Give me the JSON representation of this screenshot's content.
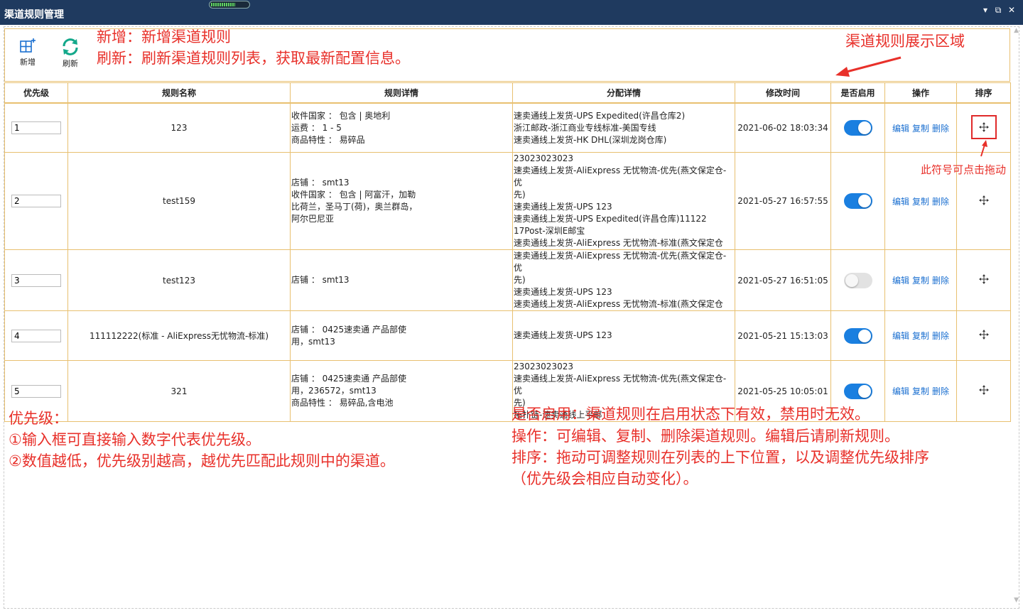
{
  "window": {
    "title": "渠道规则管理",
    "progress_fraction": 0.65,
    "controls": [
      "▾",
      "⧉",
      "✕"
    ]
  },
  "toolbar": {
    "add_label": "新增",
    "refresh_label": "刷新"
  },
  "annotations": {
    "toolbar_line1": "新增：新增渠道规则",
    "toolbar_line2": "刷新：刷新渠道规则列表，获取最新配置信息。",
    "display_area": "渠道规则展示区域",
    "drag_hint": "此符号可点击拖动",
    "priority_title": "优先级：",
    "priority_line1": "①输入框可直接输入数字代表优先级。",
    "priority_line2": "②数值越低，优先级别越高，越优先匹配此规则中的渠道。",
    "enable_line": "是否启用：渠道规则在启用状态下有效，禁用时无效。",
    "operation_line": "操作：可编辑、复制、删除渠道规则。编辑后请刷新规则。",
    "sort_line1": "排序：拖动可调整规则在列表的上下位置，以及调整优先级排序",
    "sort_line2": "（优先级会相应自动变化）。",
    "arrow_color": "#e8302a"
  },
  "table": {
    "headers": {
      "priority": "优先级",
      "name": "规则名称",
      "detail": "规则详情",
      "allocation": "分配详情",
      "modified": "修改时间",
      "enabled": "是否启用",
      "operation": "操作",
      "sort": "排序"
    },
    "op_labels": {
      "edit": "编辑",
      "copy": "复制",
      "delete": "删除"
    },
    "rows": [
      {
        "priority": "1",
        "name": "123",
        "detail": [
          "收件国家 ： 包含 | 奥地利",
          "运费 ： 1 - 5",
          "商品特性 ： 易碎品"
        ],
        "allocation": [
          "速卖通线上发货-UPS Expedited(许昌仓库2)",
          "浙江邮政-浙江商业专线标准-美国专线",
          "速卖通线上发货-HK DHL(深圳龙岗仓库)"
        ],
        "modified": "2021-06-02 18:03:34",
        "enabled": true
      },
      {
        "priority": "2",
        "name": "test159",
        "detail": [
          "店铺 ： smt13",
          "收件国家 ： 包含 | 阿富汗，加勒",
          "比荷兰，圣马丁(荷)，奥兰群岛，",
          "阿尔巴尼亚"
        ],
        "allocation": [
          "23023023023",
          "速卖通线上发货-AliExpress 无忧物流-优先(燕文保定仓-优",
          "先)",
          "速卖通线上发货-UPS 123",
          "速卖通线上发货-UPS Expedited(许昌仓库)11122",
          "17Post-深圳E邮宝",
          "速卖通线上发货-AliExpress 无忧物流-标准(燕文保定仓"
        ],
        "modified": "2021-05-27 16:57:55",
        "enabled": true
      },
      {
        "priority": "3",
        "name": "test123",
        "detail": [
          "店铺 ： smt13"
        ],
        "allocation": [
          "速卖通线上发货-AliExpress 无忧物流-优先(燕文保定仓-优",
          "先)",
          "速卖通线上发货-UPS 123",
          "速卖通线上发货-AliExpress 无忧物流-标准(燕文保定仓"
        ],
        "modified": "2021-05-27 16:51:05",
        "enabled": false
      },
      {
        "priority": "4",
        "name": "111112222(标准 - AliExpress无忧物流-标准)",
        "detail": [
          "店铺 ： 0425速卖通  产品部使",
          "用，smt13"
        ],
        "allocation": [
          "速卖通线上发货-UPS 123"
        ],
        "modified": "2021-05-21 15:13:03",
        "enabled": true
      },
      {
        "priority": "5",
        "name": "321",
        "detail": [
          "店铺 ： 0425速卖通  产品部使",
          "用，236572，smt13",
          "商品特性 ： 易碎品,含电池"
        ],
        "allocation": [
          "23023023023",
          "速卖通线上发货-AliExpress 无忧物流-优先(燕文保定仓-优",
          "先)",
          "拓扑链-速卖通线上平邮"
        ],
        "modified": "2021-05-25 10:05:01",
        "enabled": true
      }
    ]
  }
}
